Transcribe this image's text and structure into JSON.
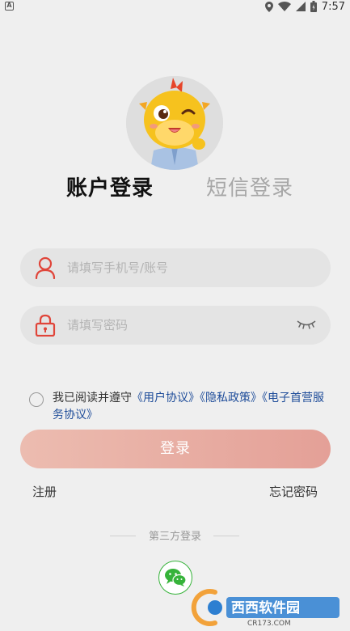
{
  "status_bar": {
    "time": "7:57"
  },
  "tabs": {
    "account_login": "账户登录",
    "sms_login": "短信登录"
  },
  "username_field": {
    "placeholder": "请填写手机号/账号"
  },
  "password_field": {
    "placeholder": "请填写密码"
  },
  "agreement": {
    "prefix": "我已阅读并遵守",
    "user_agreement": "《用户协议》",
    "privacy_policy": "《隐私政策》",
    "service_agreement": "《电子首营服务协议》"
  },
  "login_button": "登录",
  "register_link": "注册",
  "forgot_password_link": "忘记密码",
  "third_party_label": "第三方登录",
  "watermark": {
    "brand": "西西软件园",
    "site": "CR173.COM"
  },
  "colors": {
    "accent": "#e4a097",
    "link": "#1f4d9a",
    "wechat": "#36b33a"
  }
}
